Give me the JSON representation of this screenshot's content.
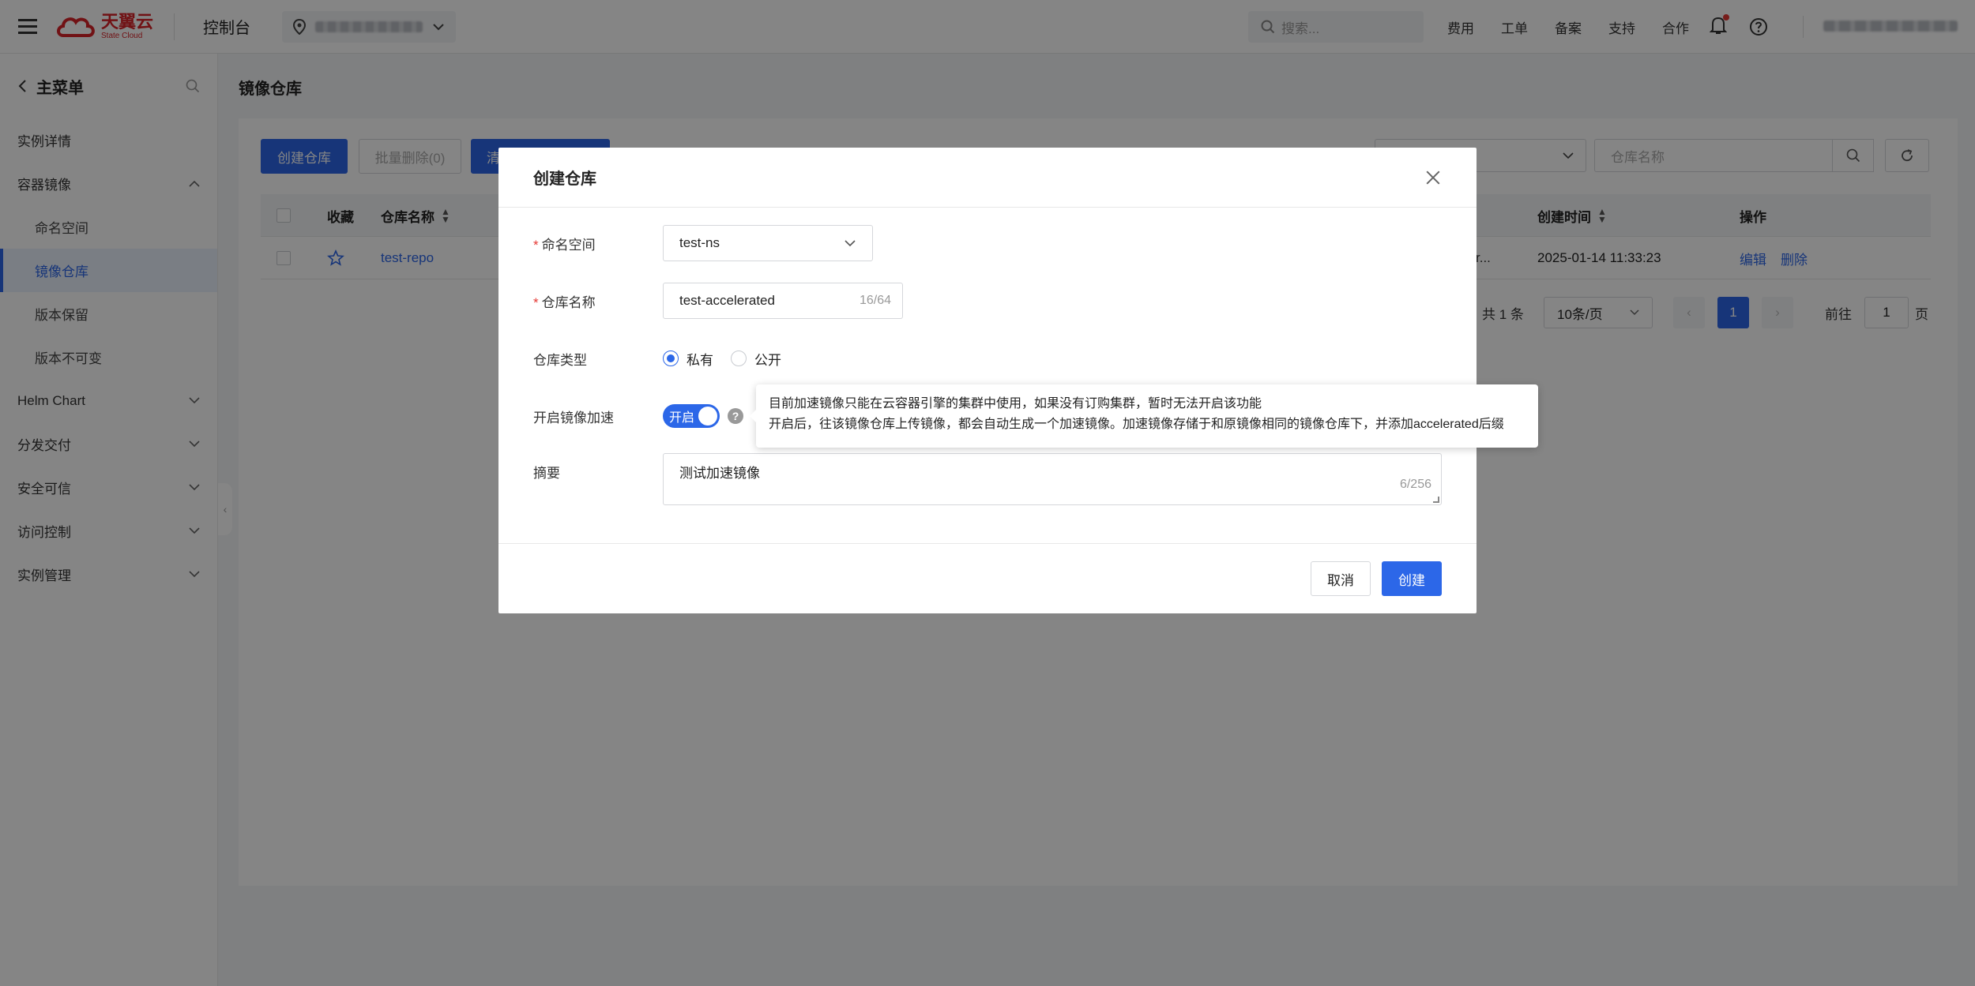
{
  "topbar": {
    "logo_cn": "天翼云",
    "logo_en": "State Cloud",
    "console": "控制台",
    "search_placeholder": "搜索...",
    "nav": [
      "费用",
      "工单",
      "备案",
      "支持",
      "合作"
    ]
  },
  "sidebar": {
    "title": "主菜单",
    "items": [
      {
        "label": "实例详情"
      },
      {
        "label": "容器镜像"
      },
      {
        "label": "命名空间"
      },
      {
        "label": "镜像仓库"
      },
      {
        "label": "版本保留"
      },
      {
        "label": "版本不可变"
      },
      {
        "label": "Helm Chart"
      },
      {
        "label": "分发交付"
      },
      {
        "label": "安全可信"
      },
      {
        "label": "访问控制"
      },
      {
        "label": "实例管理"
      }
    ]
  },
  "page": {
    "title": "镜像仓库",
    "create_btn": "创建仓库",
    "batch_delete_btn": "批量删除(0)",
    "third_btn_partial": "清",
    "search_placeholder": "仓库名称",
    "columns": [
      "收藏",
      "仓库名称",
      "创建时间",
      "操作"
    ],
    "row": {
      "name": "test-repo",
      "truncated": "r...",
      "created": "2025-01-14 11:33:23",
      "edit": "编辑",
      "delete": "删除"
    },
    "pager": {
      "total": "共 1 条",
      "size": "10条/页",
      "current": "1",
      "goto_label": "前往",
      "goto_value": "1",
      "page_suffix": "页"
    }
  },
  "modal": {
    "title": "创建仓库",
    "namespace_label": "命名空间",
    "namespace_value": "test-ns",
    "repo_name_label": "仓库名称",
    "repo_name_value": "test-accelerated",
    "repo_name_count": "16/64",
    "repo_type_label": "仓库类型",
    "repo_type_private": "私有",
    "repo_type_public": "公开",
    "accel_label": "开启镜像加速",
    "accel_switch": "开启",
    "summary_label": "摘要",
    "summary_value": "测试加速镜像",
    "summary_count": "6/256",
    "cancel": "取消",
    "create": "创建"
  },
  "tooltip": {
    "line1": "目前加速镜像只能在云容器引擎的集群中使用，如果没有订购集群，暂时无法开启该功能",
    "line2": "开启后，往该镜像仓库上传镜像，都会自动生成一个加速镜像。加速镜像存储于和原镜像相同的镜像仓库下，并添加accelerated后缀"
  },
  "colors": {
    "primary": "#2c67e8",
    "brand_red": "#d8242a"
  }
}
